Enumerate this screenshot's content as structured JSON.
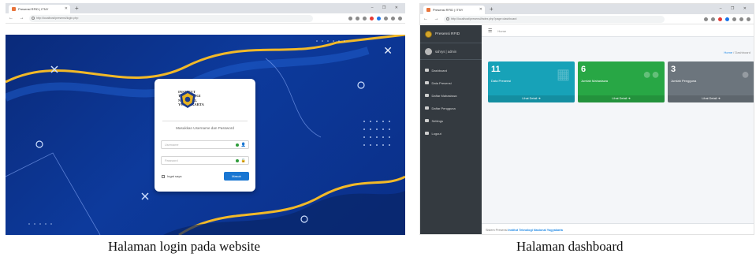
{
  "login_screen": {
    "browser": {
      "tab_title": "Presensi RFID | ITNY",
      "url": "http://localhost/presensi/login.php",
      "new_tab": "+",
      "window_controls": "– ❐ ✕",
      "nav": "← → C"
    },
    "card": {
      "institution": [
        "INSTITUT",
        "TEKNOLOGI",
        "NASIONAL",
        "YOGYAKARTA"
      ],
      "hint": "Masukkan Username dan Password",
      "username_placeholder": "Username",
      "password_placeholder": "Password",
      "remember_label": "Ingat saya",
      "submit_label": "Masuk"
    },
    "close_glyph": "✕",
    "colors": {
      "background": "#0d3a9c",
      "accent_wave": "#f2b928",
      "button": "#1976d2"
    }
  },
  "dashboard_screen": {
    "browser": {
      "tab_title": "Presensi RFID | ITNY",
      "url": "http://localhost/presensi/index.php?page=dashboard",
      "new_tab": "+",
      "window_controls": "– ❐ ✕",
      "nav": "← → C"
    },
    "sidebar": {
      "brand": "Presensi RFID",
      "user": "sahrys | admin",
      "items": [
        {
          "label": "Dashboard",
          "icon": "dashboard-icon"
        },
        {
          "label": "Data Presensi",
          "icon": "calendar-icon"
        },
        {
          "label": "Daftar Mahasiswa",
          "icon": "users-icon"
        },
        {
          "label": "Daftar Pengguna",
          "icon": "user-icon"
        },
        {
          "label": "Settings",
          "icon": "gear-icon"
        },
        {
          "label": "Logout",
          "icon": "power-icon"
        }
      ]
    },
    "topnav": {
      "home": "Home"
    },
    "breadcrumb": {
      "home": "Home",
      "separator": "/",
      "current": "Dashboard"
    },
    "cards": [
      {
        "number": "11",
        "label": "Data Presensi",
        "footer": "Lihat Detail",
        "icon": "calendar-icon",
        "color": "#17a2b8"
      },
      {
        "number": "6",
        "label": "Jumlah Mahasiswa",
        "footer": "Lihat Detail",
        "icon": "users-icon",
        "color": "#28a745"
      },
      {
        "number": "3",
        "label": "Jumlah Pengguna",
        "footer": "Lihat Detail",
        "icon": "user-icon",
        "color": "#6c757d"
      }
    ],
    "footer": {
      "prefix": "Sistem Presensi",
      "link": "Institut Teknologi Nasional Yogyakarta"
    }
  },
  "captions": {
    "left": "Halaman login pada website",
    "right": "Halaman dashboard"
  }
}
